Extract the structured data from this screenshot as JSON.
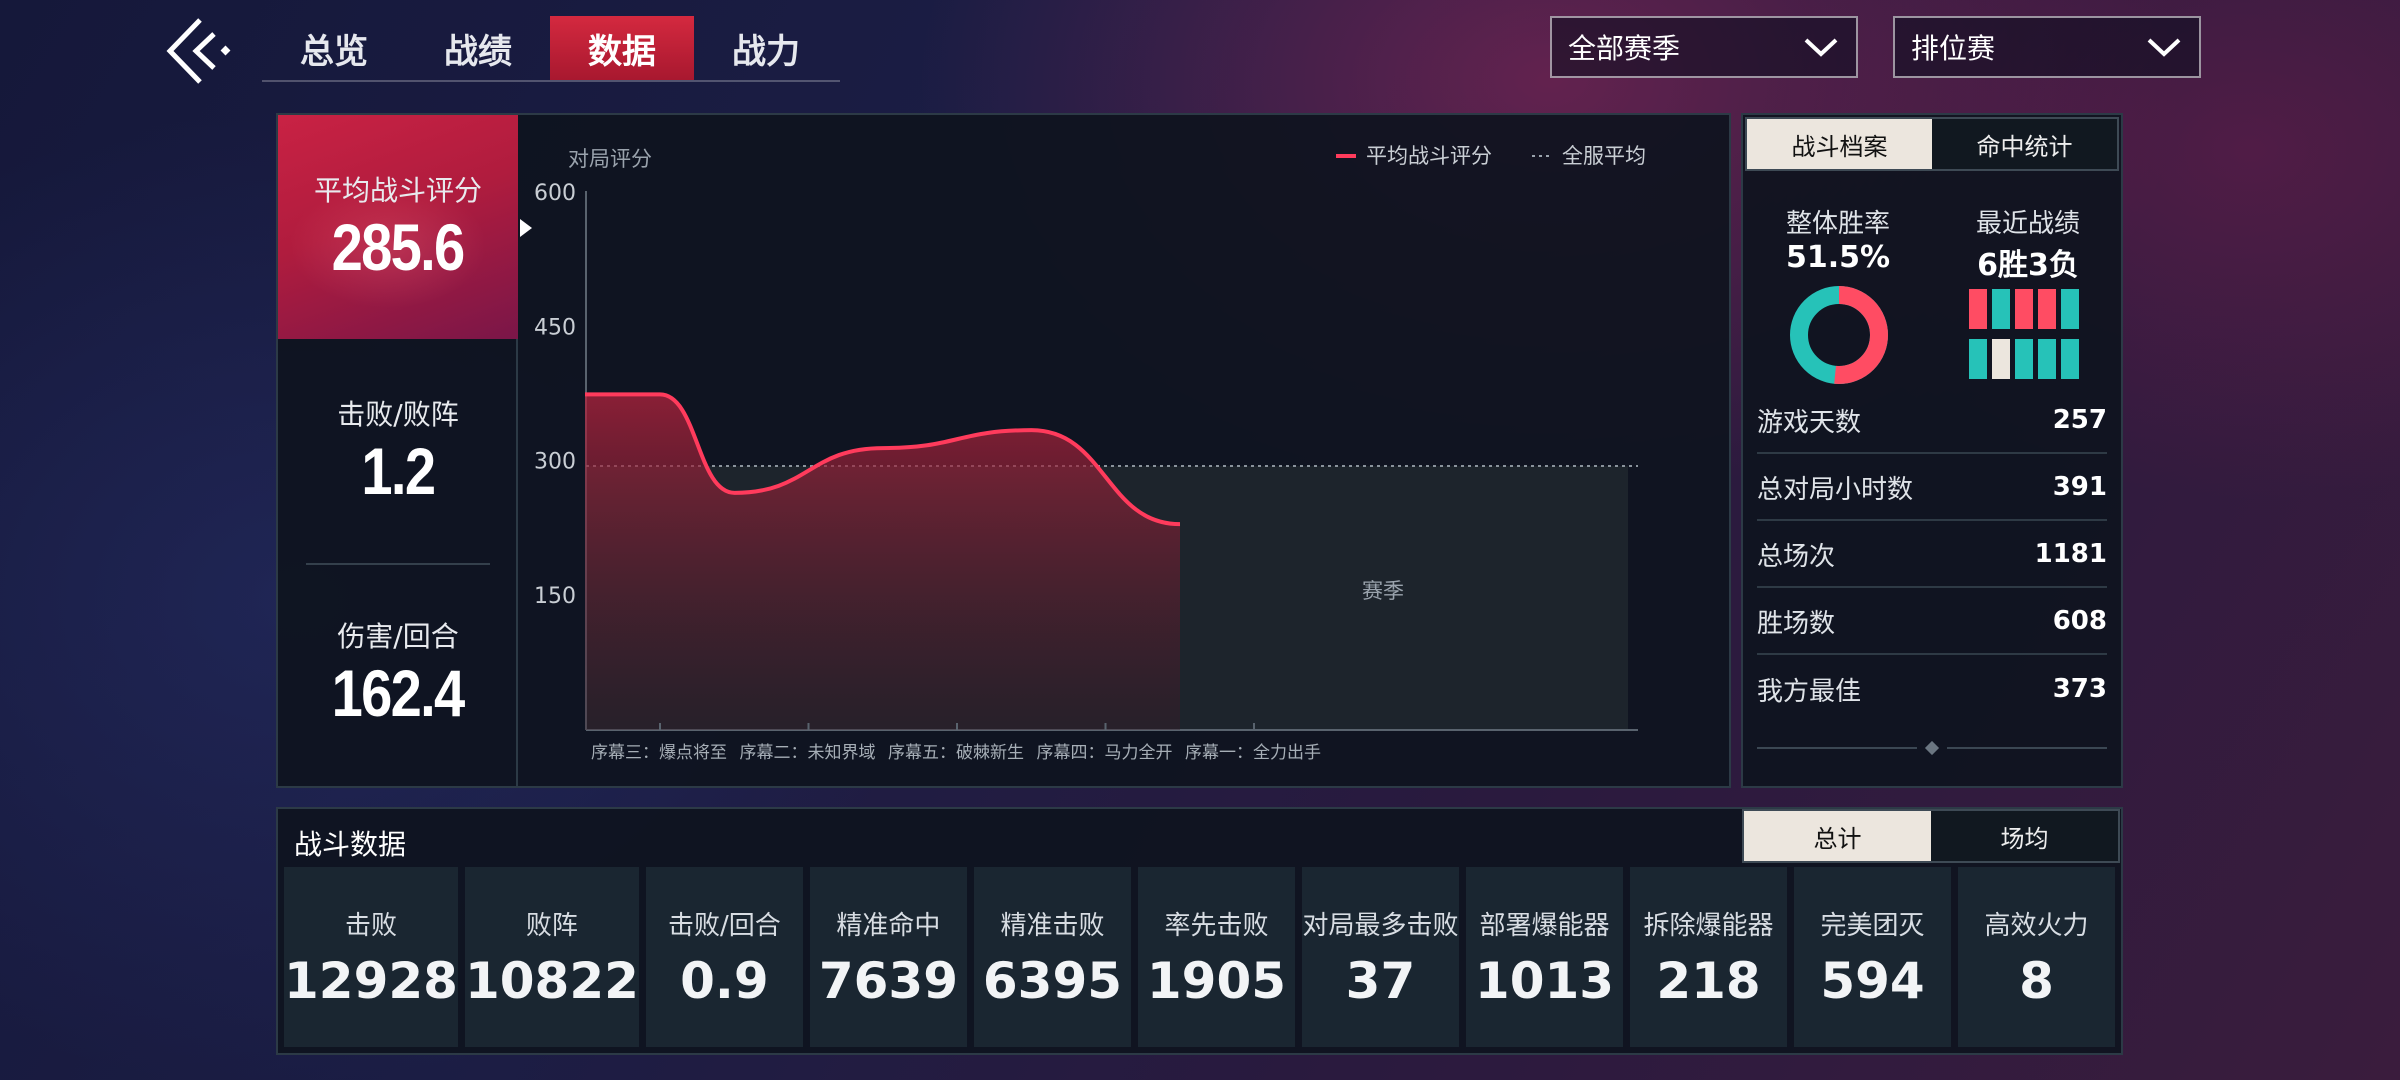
{
  "nav": {
    "tabs": [
      {
        "label": "总览"
      },
      {
        "label": "战绩"
      },
      {
        "label": "数据"
      },
      {
        "label": "战力"
      }
    ],
    "active_tab_index": 2,
    "season_select": "全部赛季",
    "mode_select": "排位赛"
  },
  "summary": {
    "rating_label": "平均战斗评分",
    "rating_value": "285.6",
    "kd_label": "击败/败阵",
    "kd_value": "1.2",
    "dmg_label": "伤害/回合",
    "dmg_value": "162.4"
  },
  "chart_data": {
    "type": "line",
    "ylabel": "对局评分",
    "xlabel": "赛季",
    "ylim": [
      0,
      600
    ],
    "yticks": [
      600,
      450,
      300,
      150
    ],
    "categories": [
      "序幕三：爆点将至",
      "序幕二：未知界域",
      "序幕五：破棘新生",
      "序幕四：马力全开",
      "序幕一：全力出手"
    ],
    "series": [
      {
        "name": "平均战斗评分",
        "values": [
          375,
          265,
          315,
          335,
          230
        ],
        "color": "#ff3b5c"
      }
    ],
    "reference": {
      "name": "全服平均",
      "value": 295
    },
    "legend": "top-right"
  },
  "profile": {
    "tab_on": "战斗档案",
    "tab_off": "命中统计",
    "winrate_title": "整体胜率",
    "winrate_value": "51.5%",
    "winrate_fraction": 0.515,
    "recent_title": "最近战绩",
    "recent_value": "6胜3负",
    "recent_grid": [
      [
        "loss",
        "win",
        "loss",
        "loss",
        "win"
      ],
      [
        "win",
        "draw",
        "win",
        "win",
        "win"
      ]
    ],
    "rows": [
      {
        "label": "游戏天数",
        "value": "257"
      },
      {
        "label": "总对局小时数",
        "value": "391"
      },
      {
        "label": "总场次",
        "value": "1181"
      },
      {
        "label": "胜场数",
        "value": "608"
      },
      {
        "label": "我方最佳",
        "value": "373"
      }
    ]
  },
  "combat": {
    "title": "战斗数据",
    "tab_on": "总计",
    "tab_off": "场均",
    "cards": [
      {
        "label": "击败",
        "value": "12928"
      },
      {
        "label": "败阵",
        "value": "10822"
      },
      {
        "label": "击败/回合",
        "value": "0.9"
      },
      {
        "label": "精准命中",
        "value": "7639"
      },
      {
        "label": "精准击败",
        "value": "6395"
      },
      {
        "label": "率先击败",
        "value": "1905"
      },
      {
        "label": "对局最多击败",
        "value": "37"
      },
      {
        "label": "部署爆能器",
        "value": "1013"
      },
      {
        "label": "拆除爆能器",
        "value": "218"
      },
      {
        "label": "完美团灭",
        "value": "594"
      },
      {
        "label": "高效火力",
        "value": "8"
      }
    ]
  },
  "colors": {
    "accent": "#d4293f",
    "win": "#26c2b8",
    "loss": "#ff4c63",
    "draw": "#ece6de"
  }
}
